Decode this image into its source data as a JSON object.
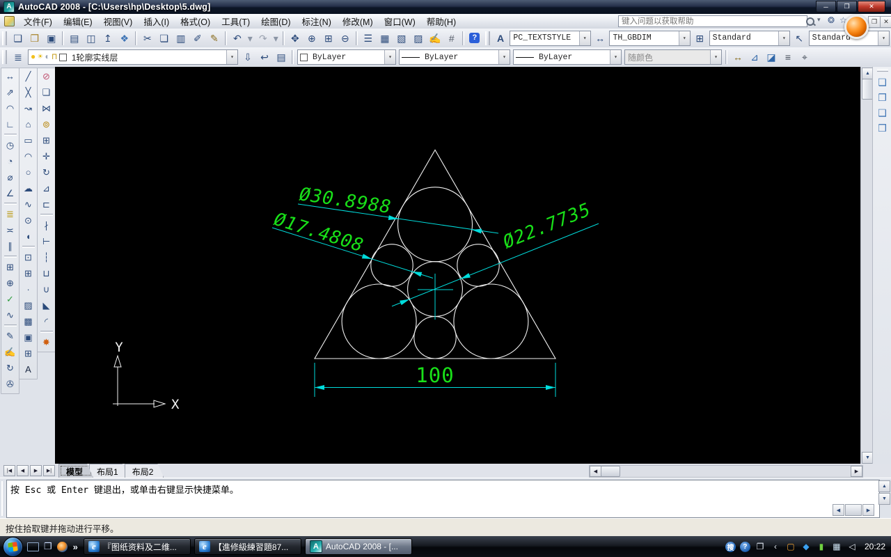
{
  "window": {
    "title": "AutoCAD 2008 - [C:\\Users\\hp\\Desktop\\5.dwg]",
    "app_icon_glyph": "A",
    "minimize": "─",
    "restore": "❐",
    "close": "✕"
  },
  "menu": {
    "items": [
      {
        "name": "file",
        "label": "文件(F)"
      },
      {
        "name": "edit",
        "label": "编辑(E)"
      },
      {
        "name": "view",
        "label": "视图(V)"
      },
      {
        "name": "insert",
        "label": "插入(I)"
      },
      {
        "name": "format",
        "label": "格式(O)"
      },
      {
        "name": "tools",
        "label": "工具(T)"
      },
      {
        "name": "draw",
        "label": "绘图(D)"
      },
      {
        "name": "dimension",
        "label": "标注(N)"
      },
      {
        "name": "modify",
        "label": "修改(M)"
      },
      {
        "name": "window",
        "label": "窗口(W)"
      },
      {
        "name": "help",
        "label": "帮助(H)"
      }
    ],
    "help_hint": "键入问题以获取帮助",
    "mdi_restore": "❐",
    "mdi_close": "✕"
  },
  "toolbar_standard": [
    {
      "name": "new",
      "g": "❑"
    },
    {
      "name": "open",
      "g": "❒",
      "c": "#a8842c"
    },
    {
      "name": "save",
      "g": "▣"
    },
    {
      "sep": 1
    },
    {
      "name": "plot",
      "g": "▤"
    },
    {
      "name": "plot-preview",
      "g": "◫"
    },
    {
      "name": "publish",
      "g": "↥"
    },
    {
      "name": "3d-dwf",
      "g": "❖",
      "c": "#3f75b5"
    },
    {
      "sep": 1
    },
    {
      "name": "cut",
      "g": "✂"
    },
    {
      "name": "copy",
      "g": "❏"
    },
    {
      "name": "paste",
      "g": "▥"
    },
    {
      "name": "match-properties",
      "g": "✐"
    },
    {
      "name": "block-editor",
      "g": "✎",
      "c": "#8a6d1d"
    },
    {
      "sep": 1
    },
    {
      "name": "undo",
      "g": "↶"
    },
    {
      "name": "undo-menu",
      "g": "▾",
      "k": "narrow",
      "c": "#8b95a5"
    },
    {
      "name": "redo",
      "g": "↷",
      "c": "#9aa2af"
    },
    {
      "name": "redo-menu",
      "g": "▾",
      "k": "narrow",
      "c": "#8b95a5"
    },
    {
      "sep": 1
    },
    {
      "name": "pan",
      "g": "✥"
    },
    {
      "name": "zoom-realtime",
      "g": "⊕"
    },
    {
      "name": "zoom-window",
      "g": "⊞"
    },
    {
      "name": "zoom-previous",
      "g": "⊖"
    },
    {
      "sep": 1
    },
    {
      "name": "properties",
      "g": "☰"
    },
    {
      "name": "designcenter",
      "g": "▦"
    },
    {
      "name": "tool-palettes",
      "g": "▧"
    },
    {
      "name": "sheet-set-manager",
      "g": "▨"
    },
    {
      "name": "markup-set-manager",
      "g": "✍",
      "c": "#a23b8f"
    },
    {
      "name": "quickcalc",
      "g": "#",
      "c": "#555d69"
    },
    {
      "sep": 1
    },
    {
      "name": "help",
      "g": "?",
      "k": "helpbtn"
    }
  ],
  "styles_toolbar": {
    "text_style_icon": "A",
    "text_style": "PC_TEXTSTYLE",
    "dim_style_icon": "↔",
    "dim_style": "TH_GBDIM",
    "table_style_icon": "⊞",
    "table_style": "Standard",
    "mleader_style_icon": "↖",
    "mleader_style": "Standard",
    "drop_glyph": "▾"
  },
  "layer_toolbar": {
    "manager_glyph": "≣",
    "current_layer": "1轮廓实线层",
    "combo_icons": [
      {
        "name": "layer-on",
        "g": "●",
        "c": "#f2c01d"
      },
      {
        "name": "layer-freeze",
        "g": "☀",
        "c": "#e0b400"
      },
      {
        "name": "layer-vp-freeze",
        "g": "◐",
        "c": "#9aa5b5"
      },
      {
        "name": "layer-lock",
        "g": "⊓",
        "c": "#c49a10"
      }
    ],
    "extra_icons": [
      {
        "name": "make-object-layer-current",
        "g": "⇩",
        "c": "#2b4a7a"
      },
      {
        "name": "layer-previous",
        "g": "↩",
        "c": "#2b4a7a"
      },
      {
        "name": "layer-states",
        "g": "▤",
        "c": "#2b4a7a"
      }
    ]
  },
  "properties_toolbar": {
    "color": "ByLayer",
    "linetype": "ByLayer",
    "lineweight": "ByLayer",
    "plot_style": "随颜色"
  },
  "inquiry_toolbar": [
    {
      "name": "distance",
      "g": "↔",
      "c": "#8a6d1d"
    },
    {
      "name": "area",
      "g": "⊿",
      "c": "#2f66a8"
    },
    {
      "name": "mass-properties",
      "g": "◪",
      "c": "#2f66a8"
    },
    {
      "name": "list",
      "g": "≡",
      "c": "#444c58"
    },
    {
      "name": "locate-point",
      "g": "⌖",
      "c": "#444c58"
    }
  ],
  "dim_toolbar": [
    {
      "name": "linear-dimension",
      "g": "↔"
    },
    {
      "name": "aligned-dimension",
      "g": "⇗"
    },
    {
      "name": "arc-length-dimension",
      "g": "◠"
    },
    {
      "name": "ordinate-dimension",
      "g": "∟"
    },
    {
      "sep": 1
    },
    {
      "name": "radius-dimension",
      "g": "◷"
    },
    {
      "name": "jogged-dimension",
      "g": "◔"
    },
    {
      "name": "diameter-dimension",
      "g": "⌀"
    },
    {
      "name": "angular-dimension",
      "g": "∠"
    },
    {
      "sep": 1
    },
    {
      "name": "quick-dimension",
      "g": "≣",
      "c": "#b8960c"
    },
    {
      "name": "baseline-dimension",
      "g": "≍"
    },
    {
      "name": "continue-dimension",
      "g": "∥"
    },
    {
      "sep": 1
    },
    {
      "name": "tolerance",
      "g": "⊞"
    },
    {
      "name": "center-mark",
      "g": "⊕"
    },
    {
      "name": "dimension-inspect",
      "g": "✓",
      "c": "#2c9c3c"
    },
    {
      "name": "jogged-linear",
      "g": "∿"
    },
    {
      "sep": 1
    },
    {
      "name": "dimension-edit",
      "g": "✎"
    },
    {
      "name": "dimension-text-edit",
      "g": "✍"
    },
    {
      "name": "dimension-update",
      "g": "↻"
    },
    {
      "name": "dimension-style",
      "g": "✇"
    }
  ],
  "draw_toolbar": [
    {
      "name": "line",
      "g": "╱"
    },
    {
      "name": "construction-line",
      "g": "╳"
    },
    {
      "name": "polyline",
      "g": "↝"
    },
    {
      "name": "polygon",
      "g": "⌂"
    },
    {
      "name": "rectangle",
      "g": "▭"
    },
    {
      "name": "arc",
      "g": "◠"
    },
    {
      "name": "circle",
      "g": "○"
    },
    {
      "name": "revision-cloud",
      "g": "☁"
    },
    {
      "name": "spline",
      "g": "∿"
    },
    {
      "name": "ellipse",
      "g": "⊙"
    },
    {
      "name": "ellipse-arc",
      "g": "◖"
    },
    {
      "sep": 1
    },
    {
      "name": "insert-block",
      "g": "⊡"
    },
    {
      "name": "make-block",
      "g": "⊞"
    },
    {
      "name": "point",
      "g": "∙"
    },
    {
      "name": "hatch",
      "g": "▨"
    },
    {
      "name": "gradient",
      "g": "▩"
    },
    {
      "name": "region",
      "g": "▣"
    },
    {
      "name": "table",
      "g": "⊞"
    },
    {
      "name": "multiline-text",
      "g": "A",
      "c": "#1c2a44"
    }
  ],
  "modify_toolbar": [
    {
      "name": "erase",
      "g": "⊘",
      "c": "#c05070"
    },
    {
      "name": "copy-object",
      "g": "❏"
    },
    {
      "name": "mirror",
      "g": "⋈"
    },
    {
      "name": "offset",
      "g": "⊚",
      "c": "#b8860b"
    },
    {
      "name": "array",
      "g": "⊞"
    },
    {
      "name": "move",
      "g": "✛"
    },
    {
      "name": "rotate",
      "g": "↻"
    },
    {
      "name": "scale",
      "g": "⊿"
    },
    {
      "name": "stretch",
      "g": "⊏"
    },
    {
      "sep": 1
    },
    {
      "name": "trim",
      "g": "∤"
    },
    {
      "name": "extend",
      "g": "⊢"
    },
    {
      "name": "break-at-point",
      "g": "┆"
    },
    {
      "name": "break",
      "g": "⊔"
    },
    {
      "name": "join",
      "g": "∪"
    },
    {
      "name": "chamfer",
      "g": "◣"
    },
    {
      "name": "fillet",
      "g": "◜"
    },
    {
      "sep": 1
    },
    {
      "name": "explode",
      "g": "✸",
      "c": "#d06010"
    }
  ],
  "draworder_toolbar": [
    {
      "name": "bring-to-front",
      "g": "❏",
      "c": "#3f75b5"
    },
    {
      "name": "send-to-back",
      "g": "❐",
      "c": "#3f75b5"
    },
    {
      "name": "bring-above-objects",
      "g": "❑",
      "c": "#3f75b5"
    },
    {
      "name": "send-under-objects",
      "g": "❒",
      "c": "#3f75b5"
    }
  ],
  "drawing": {
    "dims": {
      "top": "Ø30.8988",
      "left": "Ø17.4808",
      "right": "Ø22.7735",
      "base": "100"
    },
    "ucs": {
      "x_label": "X",
      "y_label": "Y"
    },
    "colors": {
      "background": "#000000",
      "geometry": "#f2f2f2",
      "dimension_lines": "#00dcdc",
      "dimension_text": "#19e019"
    }
  },
  "layout_tabs": {
    "nav": [
      {
        "name": "first-tab",
        "g": "|◀"
      },
      {
        "name": "previous-tab",
        "g": "◀"
      },
      {
        "name": "next-tab",
        "g": "▶"
      },
      {
        "name": "last-tab",
        "g": "▶|"
      }
    ],
    "items": [
      {
        "name": "model",
        "label": "模型",
        "active": true
      },
      {
        "name": "layout1",
        "label": "布局1"
      },
      {
        "name": "layout2",
        "label": "布局2"
      }
    ]
  },
  "command": {
    "history": "按 Esc 或 Enter 键退出，或单击右键显示快捷菜单。"
  },
  "status": {
    "message": "按住拾取键并拖动进行平移。"
  },
  "taskbar": {
    "chevron": "»",
    "buttons": [
      {
        "name": "ie-window-1",
        "icon": "ie",
        "label": "『图纸资料及二维..."
      },
      {
        "name": "ie-window-2",
        "icon": "ie",
        "label": "【進修級練習題87..."
      },
      {
        "name": "autocad-window",
        "icon": "acad",
        "label": "AutoCAD 2008 - [...",
        "active": true
      }
    ],
    "tray": [
      {
        "name": "sogou",
        "g": "搜",
        "k": "circ"
      },
      {
        "name": "help-center",
        "g": "?",
        "k": "circ"
      },
      {
        "name": "restore-window",
        "g": "❐"
      },
      {
        "name": "chevron-left",
        "g": "‹"
      },
      {
        "name": "display",
        "g": "▢",
        "c": "#f0a030"
      },
      {
        "name": "security-shield",
        "g": "◆",
        "c": "#3aa0f0"
      },
      {
        "name": "power",
        "g": "▮",
        "c": "#70d040"
      },
      {
        "name": "network",
        "g": "▦",
        "c": "#cfe4f4"
      },
      {
        "name": "volume",
        "g": "◁",
        "c": "#e8eef6"
      }
    ],
    "clock": "20:22"
  }
}
